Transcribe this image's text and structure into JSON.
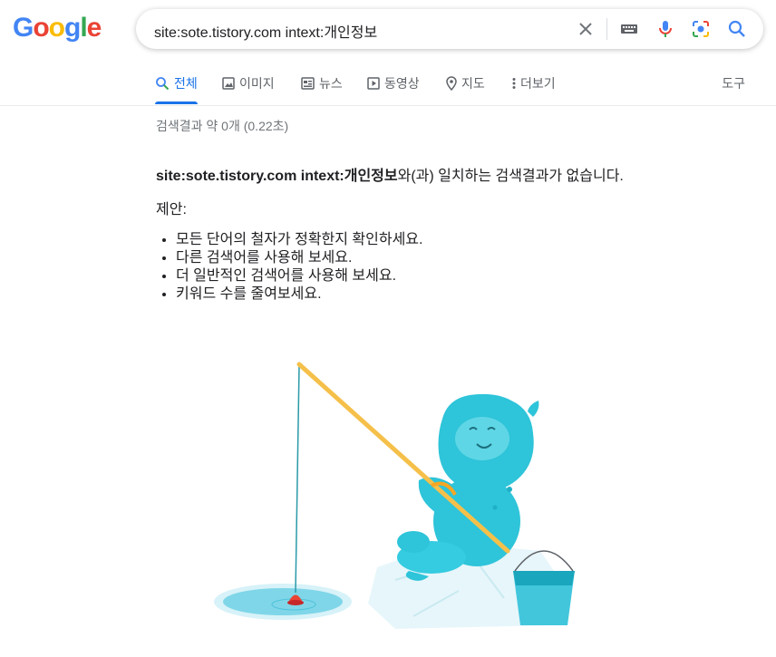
{
  "logo": {
    "letters": [
      "G",
      "o",
      "o",
      "g",
      "l",
      "e"
    ],
    "colors": [
      "#4285F4",
      "#EA4335",
      "#FBBC05",
      "#4285F4",
      "#34A853",
      "#EA4335"
    ]
  },
  "search": {
    "query": "site:sote.tistory.com intext:개인정보",
    "icons": [
      "clear-icon",
      "keyboard-icon",
      "mic-icon",
      "camera-lens-icon",
      "search-icon"
    ]
  },
  "tabs": [
    {
      "label": "전체",
      "icon": "search-icon",
      "active": true
    },
    {
      "label": "이미지",
      "icon": "image-icon"
    },
    {
      "label": "뉴스",
      "icon": "news-icon"
    },
    {
      "label": "동영상",
      "icon": "video-icon"
    },
    {
      "label": "지도",
      "icon": "map-pin-icon"
    },
    {
      "label": "더보기",
      "icon": "more-icon"
    }
  ],
  "tools_label": "도구",
  "result_stats": "검색결과 약 0개 (0.22초)",
  "no_results": {
    "query_bold": "site:sote.tistory.com intext:개인정보",
    "suffix": "와(과) 일치하는 검색결과가 없습니다."
  },
  "suggestions": {
    "title": "제안:",
    "items": [
      "모든 단어의 철자가 정확한지 확인하세요.",
      "다른 검색어를 사용해 보세요.",
      "더 일반적인 검색어를 사용해 보세요.",
      "키워드 수를 줄여보세요."
    ]
  },
  "colors": {
    "accent": "#1a73e8",
    "illustration_creature": "#2ec4d9",
    "rod": "#f5c04a",
    "bobber": "#ea4335",
    "water": "#7fd6e8"
  }
}
